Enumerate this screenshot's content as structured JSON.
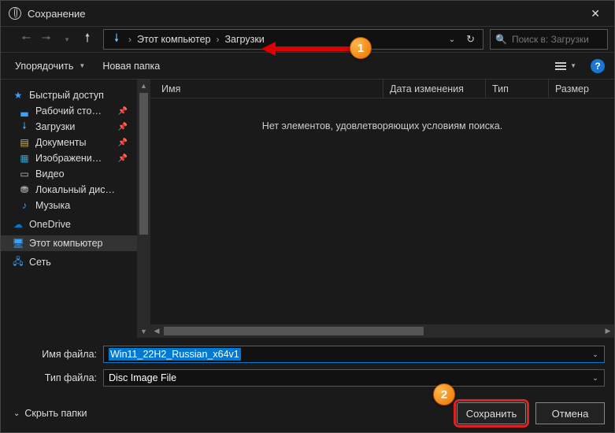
{
  "title": "Сохранение",
  "path": {
    "root": "Этот компьютер",
    "folder": "Загрузки"
  },
  "search": {
    "placeholder": "Поиск в: Загрузки"
  },
  "toolbar": {
    "organize": "Упорядочить",
    "new_folder": "Новая папка"
  },
  "sidebar": {
    "quick": "Быстрый доступ",
    "desktop": "Рабочий сто…",
    "downloads": "Загрузки",
    "documents": "Документы",
    "pictures": "Изображени…",
    "videos": "Видео",
    "localdisk": "Локальный дис…",
    "music": "Музыка",
    "onedrive": "OneDrive",
    "thispc": "Этот компьютер",
    "network": "Сеть"
  },
  "columns": {
    "name": "Имя",
    "date": "Дата изменения",
    "type": "Тип",
    "size": "Размер"
  },
  "empty": "Нет элементов, удовлетворяющих условиям поиска.",
  "fields": {
    "filename_label": "Имя файла:",
    "filename_value": "Win11_22H2_Russian_x64v1",
    "filetype_label": "Тип файла:",
    "filetype_value": "Disc Image File"
  },
  "actions": {
    "hide": "Скрыть папки",
    "save": "Сохранить",
    "cancel": "Отмена"
  },
  "annotations": {
    "b1": "1",
    "b2": "2"
  }
}
